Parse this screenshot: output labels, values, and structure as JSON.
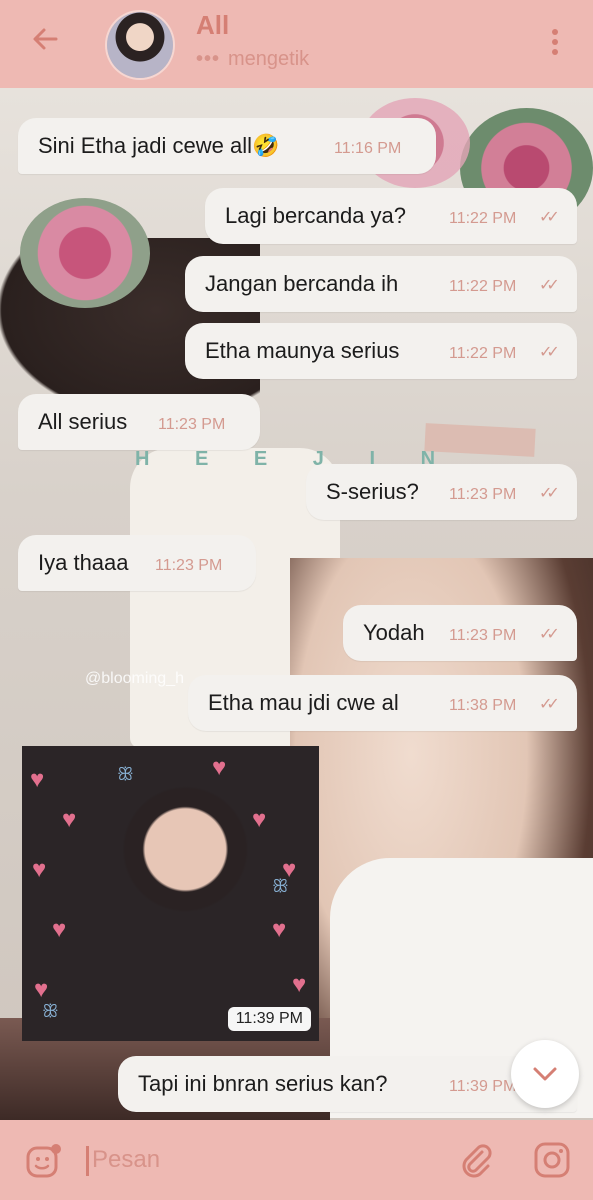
{
  "header": {
    "contact_name": "All",
    "status_dots": "•••",
    "status": "mengetik"
  },
  "messages": [
    {
      "direction": "in",
      "text": "Sini Etha jadi cewe all🤣",
      "time": "11:16 PM"
    },
    {
      "direction": "out",
      "text": "Lagi bercanda ya?",
      "time": "11:22 PM",
      "read": true
    },
    {
      "direction": "out",
      "text": "Jangan bercanda ih",
      "time": "11:22 PM",
      "read": true
    },
    {
      "direction": "out",
      "text": "Etha maunya serius",
      "time": "11:22 PM",
      "read": true
    },
    {
      "direction": "in",
      "text": "All serius",
      "time": "11:23 PM"
    },
    {
      "direction": "out",
      "text": "S-serius?",
      "time": "11:23 PM",
      "read": true
    },
    {
      "direction": "in",
      "text": "Iya thaaa",
      "time": "11:23 PM"
    },
    {
      "direction": "out",
      "text": "Yodah",
      "time": "11:23 PM",
      "read": true
    },
    {
      "direction": "out",
      "text": "Etha mau jdi cwe al",
      "time": "11:38 PM",
      "read": true
    },
    {
      "direction": "in",
      "type": "photo",
      "time": "11:39 PM"
    },
    {
      "direction": "out",
      "text": "Tapi ini bnran serius kan?",
      "time": "11:39 PM"
    }
  ],
  "wallpaper": {
    "overlay_text": "H E E J I N",
    "handle": "@blooming_h"
  },
  "input": {
    "placeholder": "Pesan"
  },
  "icons": {
    "back": "arrow-left-icon",
    "menu": "more-vertical-icon",
    "emoji": "emoji-icon",
    "attach": "paperclip-icon",
    "camera": "instagram-camera-icon",
    "scroll": "chevron-down-icon"
  },
  "colors": {
    "bar": "#eeb9b3",
    "accent": "#d57f74",
    "bubble": "#f3f1ee",
    "time": "#d49a90"
  }
}
